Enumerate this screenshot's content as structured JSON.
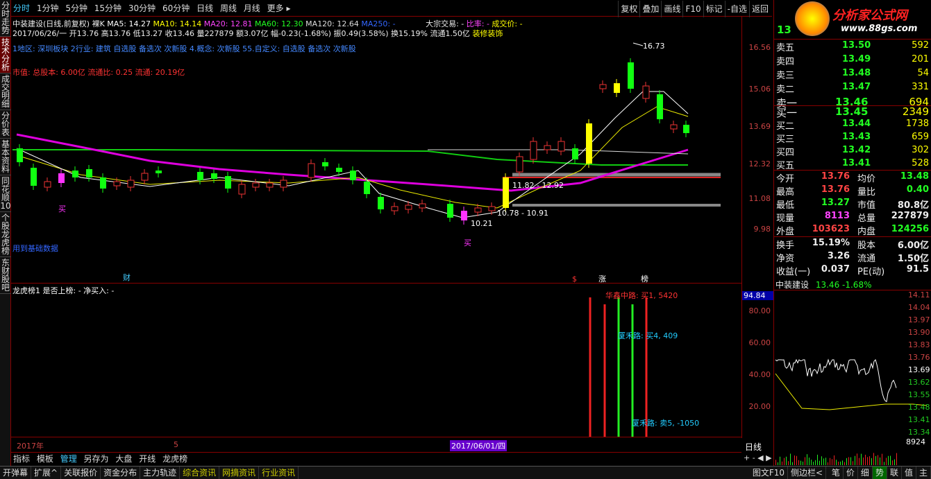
{
  "top_tabs": [
    "分时",
    "1分钟",
    "5分钟",
    "15分钟",
    "30分钟",
    "60分钟",
    "日线",
    "周线",
    "月线",
    "更多 ▸"
  ],
  "top_right_buttons": [
    "复权",
    "叠加",
    "画线",
    "F10",
    "标记",
    "-自选",
    "返回"
  ],
  "left_tabs": [
    "分时走势",
    "技术分析",
    "成交明细",
    "分价表",
    "基本资料",
    "同花顺10",
    "个股龙虎榜",
    "东财股吧"
  ],
  "info": {
    "line1": "中装建设(日线,前复权) 裸K",
    "ma5": "MA5: 14.27",
    "ma10": "MA10: 14.14",
    "ma20": "MA20: 12.81",
    "ma60": "MA60: 12.30",
    "ma120": "MA120: 12.64",
    "ma250": "MA250: -",
    "dzjy": "大宗交易: -",
    "bilv": "比率: -",
    "cjj": "成交价: -",
    "line2": "2017/06/26/一 开13.76 高13.76 低13.27 收13.46 量227879 额3.07亿 幅-0.23(-1.68%) 振0.49(3.58%) 换15.19% 流通1.50亿",
    "line2_tag": "装修装饰",
    "line3": "1地区: 深圳板块  2行业: 建筑 自选股 备选次 次新股  4.概念: 次新股  55.自定义: 自选股 备选次 次新股",
    "line4": "市值: 总股本: 6.00亿  流通比: 0.25  流通: 20.19亿"
  },
  "annotations": {
    "high": "16.73",
    "low": "10.21",
    "range1": "11.82 - 12.92",
    "range2": "10.78 - 10.91",
    "buy1": "买",
    "buy2": "买",
    "cai": "财",
    "zhang": "涨",
    "bang": "榜",
    "footnote": "用到基础数据",
    "dollar": "$"
  },
  "price_axis": [
    "16.56",
    "15.06",
    "13.69",
    "12.32",
    "11.08",
    "9.98"
  ],
  "sub": {
    "title": "龙虎榜1  是否上榜: -  净买入: -",
    "axis": [
      "94.84",
      "80.00",
      "60.00",
      "40.00",
      "20.00"
    ],
    "labels": [
      "华鑫中路: 买1, 5420",
      "厦禾路: 买4, 409",
      "厦禾路: 卖5, -1050"
    ]
  },
  "date_labels": {
    "year": "2017年",
    "month": "5",
    "cursor": "2017/06/01/四"
  },
  "period_label": "日线",
  "bottom_tabs": [
    "指标",
    "模板",
    "管理",
    "另存为",
    "大盘",
    "开线",
    "龙虎榜"
  ],
  "bottom_bar": [
    "开弹幕",
    "扩展^",
    "关联报价",
    "资金分布",
    "主力轨迹",
    "综合资讯",
    "网摘资讯",
    "行业资讯"
  ],
  "bottom_right": [
    "图文F10",
    "侧边栏<"
  ],
  "bottom_icons": [
    "笔",
    "价",
    "细",
    "势",
    "联",
    "值",
    "主"
  ],
  "stock": {
    "code": "13",
    "logo": "分析家公式网",
    "url": "www.88gs.com"
  },
  "asks": [
    [
      "卖五",
      "13.50",
      "592"
    ],
    [
      "卖四",
      "13.49",
      "201"
    ],
    [
      "卖三",
      "13.48",
      "54"
    ],
    [
      "卖二",
      "13.47",
      "331"
    ],
    [
      "卖一",
      "13.46",
      "694"
    ]
  ],
  "bids": [
    [
      "买一",
      "13.45",
      "2349"
    ],
    [
      "买二",
      "13.44",
      "1738"
    ],
    [
      "买三",
      "13.43",
      "659"
    ],
    [
      "买四",
      "13.42",
      "302"
    ],
    [
      "买五",
      "13.41",
      "528"
    ]
  ],
  "stats": [
    [
      "今开",
      "13.76",
      "均价",
      "13.48"
    ],
    [
      "最高",
      "13.76",
      "量比",
      "0.40"
    ],
    [
      "最低",
      "13.27",
      "市值",
      "80.8亿"
    ],
    [
      "现量",
      "8113",
      "总量",
      "227879"
    ],
    [
      "外盘",
      "103623",
      "内盘",
      "124256"
    ]
  ],
  "stats2": [
    [
      "换手",
      "15.19%",
      "股本",
      "6.00亿"
    ],
    [
      "净资",
      "3.26",
      "流通",
      "1.50亿"
    ],
    [
      "收益(一)",
      "0.037",
      "PE(动)",
      "91.5"
    ]
  ],
  "mini": {
    "name": "中装建设",
    "price": "13.46",
    "chg": "-1.68%",
    "axis": [
      "14.11",
      "14.04",
      "13.97",
      "13.90",
      "13.83",
      "13.76",
      "13.69",
      "13.62",
      "13.55",
      "13.48",
      "13.41",
      "13.34"
    ],
    "vol": "8924"
  }
}
